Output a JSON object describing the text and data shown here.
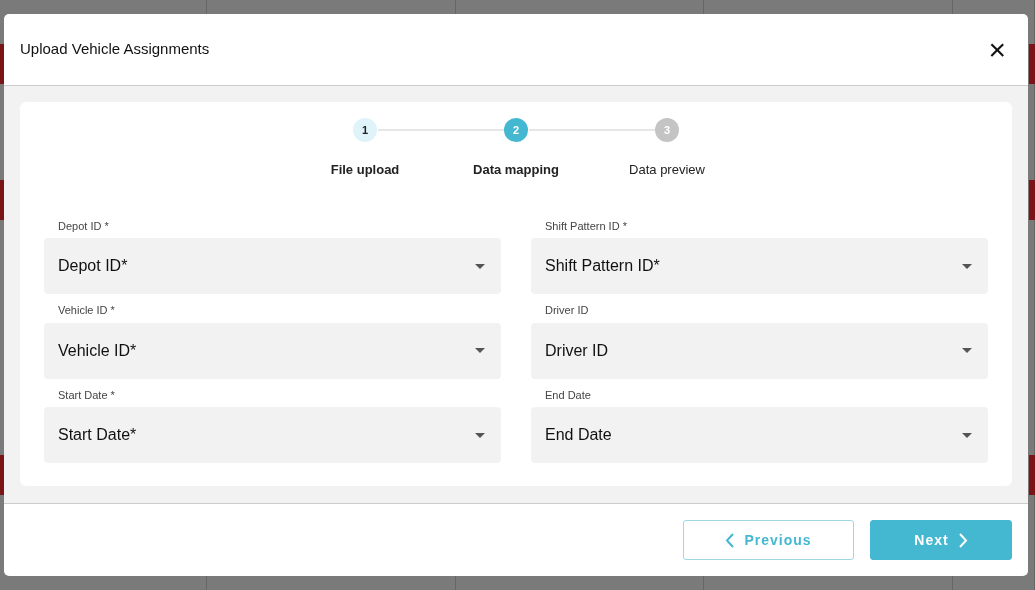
{
  "dialog": {
    "title": "Upload Vehicle Assignments",
    "close_label": "×"
  },
  "steps": [
    {
      "number": "1",
      "label": "File upload",
      "completed": true,
      "selected": false
    },
    {
      "number": "2",
      "label": "Data mapping",
      "completed": false,
      "selected": true
    },
    {
      "number": "3",
      "label": "Data preview",
      "completed": false,
      "selected": false
    }
  ],
  "fields": [
    {
      "label": "Depot ID *",
      "value": "Depot ID*"
    },
    {
      "label": "Shift Pattern ID *",
      "value": "Shift Pattern ID*"
    },
    {
      "label": "Vehicle ID *",
      "value": "Vehicle ID*"
    },
    {
      "label": "Driver ID",
      "value": "Driver ID"
    },
    {
      "label": "Start Date *",
      "value": "Start Date*"
    },
    {
      "label": "End Date",
      "value": "End Date"
    }
  ],
  "buttons": [
    {
      "label": "Previous",
      "kind": "back"
    },
    {
      "label": "Next",
      "kind": "forward"
    }
  ]
}
